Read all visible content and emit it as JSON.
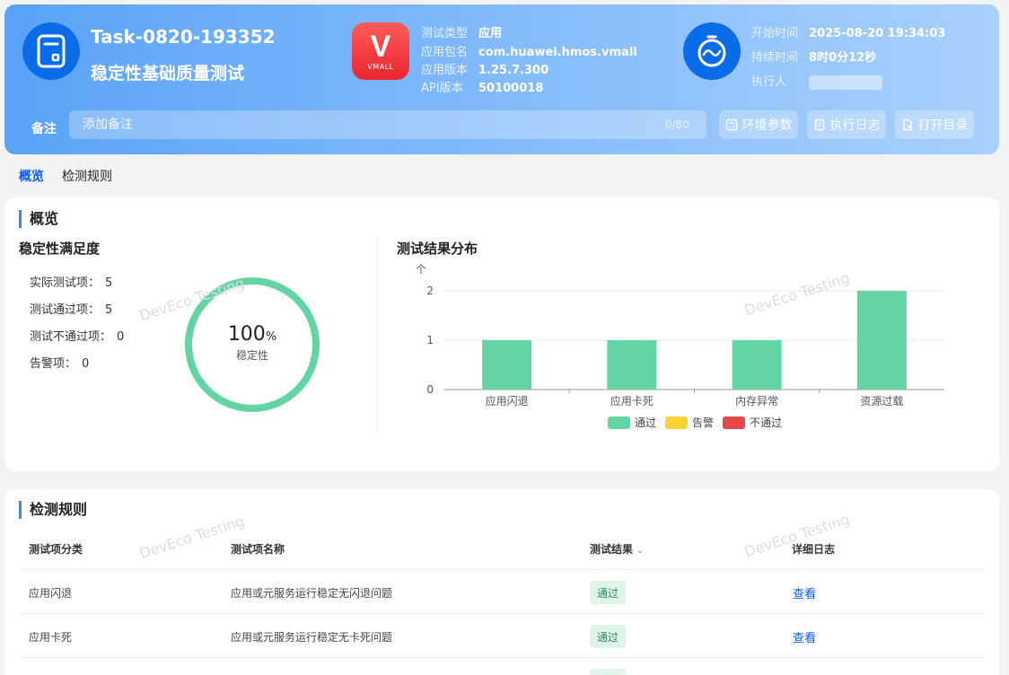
{
  "header": {
    "task_id": "Task-0820-193352",
    "task_name": "稳定性基础质量测试",
    "app_info": {
      "type_label": "测试类型",
      "type_value": "应用",
      "pkg_label": "应用包名",
      "pkg_value": "com.huawei.hmos.vmall",
      "ver_label": "应用版本",
      "ver_value": "1.25.7.300",
      "api_label": "API版本",
      "api_value": "50100018",
      "logo_text": "V",
      "logo_sub": "VMALL"
    },
    "time_info": {
      "start_label": "开始时间",
      "start_value": "2025-08-20 19:34:03",
      "duration_label": "持续时间",
      "duration_value": "8时0分12秒",
      "executor_label": "执行人"
    },
    "note": {
      "label": "备注",
      "placeholder": "添加备注",
      "count": "0/80"
    },
    "buttons": {
      "env": "环境参数",
      "log": "执行日志",
      "dir": "打开目录"
    }
  },
  "tabs": [
    "概览",
    "检测规则"
  ],
  "overview": {
    "title": "概览",
    "satisfaction_title": "稳定性满足度",
    "stats": [
      {
        "label": "实际测试项：",
        "value": "5"
      },
      {
        "label": "测试通过项：",
        "value": "5"
      },
      {
        "label": "测试不通过项：",
        "value": "0"
      },
      {
        "label": "告警项：",
        "value": "0"
      }
    ],
    "stability_value": "100",
    "stability_unit": "%",
    "stability_label": "稳定性",
    "chart_title": "测试结果分布"
  },
  "chart_data": {
    "type": "bar",
    "title": "测试结果分布",
    "ylabel": "个",
    "xlabel": "",
    "categories": [
      "应用闪退",
      "应用卡死",
      "内存异常",
      "资源过载"
    ],
    "series": [
      {
        "name": "通过",
        "values": [
          1,
          1,
          1,
          2
        ],
        "color": "#63d4a4"
      },
      {
        "name": "告警",
        "values": [
          0,
          0,
          0,
          0
        ],
        "color": "#f7d336"
      },
      {
        "name": "不通过",
        "values": [
          0,
          0,
          0,
          0
        ],
        "color": "#e54848"
      }
    ],
    "ylim": [
      0,
      2
    ],
    "yticks": [
      0,
      1,
      2
    ],
    "grid": true,
    "legend": "bottom"
  },
  "rules": {
    "title": "检测规则",
    "columns": [
      "测试项分类",
      "测试项名称",
      "测试结果",
      "详细日志"
    ],
    "rows": [
      {
        "category": "应用闪退",
        "name": "应用或元服务运行稳定无闪退问题",
        "result": "通过",
        "log": "查看"
      },
      {
        "category": "应用卡死",
        "name": "应用或元服务运行稳定无卡死问题",
        "result": "通过",
        "log": "查看"
      }
    ]
  },
  "watermark": "DevEco Testing",
  "colors": {
    "header_start": "#5aa2f7",
    "header_end": "#a9d0fc",
    "accent": "#0a59f7",
    "pass": "#63d4a4"
  }
}
